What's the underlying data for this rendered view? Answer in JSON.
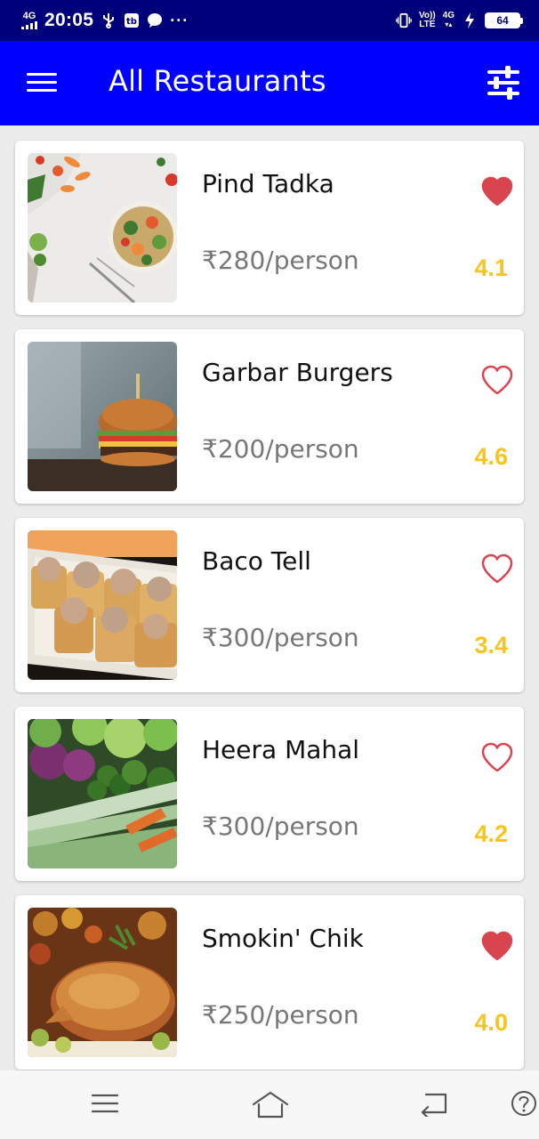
{
  "status_bar": {
    "network_left": "4G",
    "time": "20:05",
    "volte": "Vo))",
    "lte": "LTE",
    "network_right": "4G",
    "battery": "64"
  },
  "app_bar": {
    "title": "All Restaurants"
  },
  "restaurants": [
    {
      "name": "Pind Tadka",
      "price": "₹280/person",
      "rating": "4.1",
      "favorite": true,
      "image": "salad-bowl-photo"
    },
    {
      "name": "Garbar Burgers",
      "price": "₹200/person",
      "rating": "4.6",
      "favorite": false,
      "image": "burger-photo"
    },
    {
      "name": "Baco Tell",
      "price": "₹300/person",
      "rating": "3.4",
      "favorite": false,
      "image": "taco-cups-photo"
    },
    {
      "name": "Heera Mahal",
      "price": "₹300/person",
      "rating": "4.2",
      "favorite": false,
      "image": "vegetables-photo"
    },
    {
      "name": "Smokin' Chik",
      "price": "₹250/person",
      "rating": "4.0",
      "favorite": true,
      "image": "roast-chicken-photo"
    }
  ],
  "colors": {
    "status_bar": "#00007a",
    "app_bar": "#0000ff",
    "heart": "#d9454f",
    "rating": "#f7c51e"
  },
  "icons": {
    "menu": "hamburger-icon",
    "filter": "sliders-icon",
    "favorite": "heart-icon"
  }
}
